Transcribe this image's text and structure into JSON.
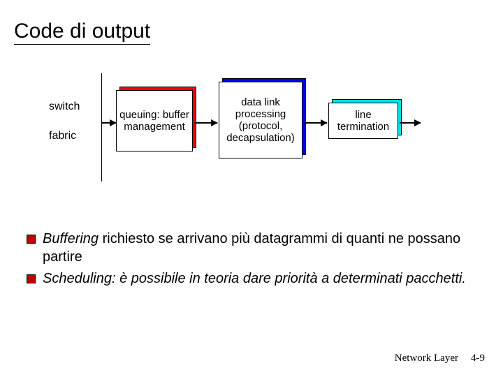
{
  "title": "Code di output",
  "diagram": {
    "left_labels": {
      "line1": "switch",
      "line2": "fabric"
    },
    "boxes": {
      "queuing": {
        "text": "queuing: buffer management",
        "shadow_color": "#ff0000"
      },
      "datalink": {
        "text": "data link processing (protocol, decapsulation)",
        "shadow_color": "#0000ff"
      },
      "line": {
        "text": "line termination",
        "shadow_color": "#00e0e0"
      }
    }
  },
  "bullets": [
    {
      "emph": "Buffering",
      "rest": " richiesto se arrivano più datagrammi di quanti ne possano partire"
    },
    {
      "emph": "Scheduling: è possibile in teoria dare priorità a determinati pacchetti.",
      "rest": ""
    }
  ],
  "footer": {
    "label": "Network Layer",
    "page": "4-9"
  }
}
